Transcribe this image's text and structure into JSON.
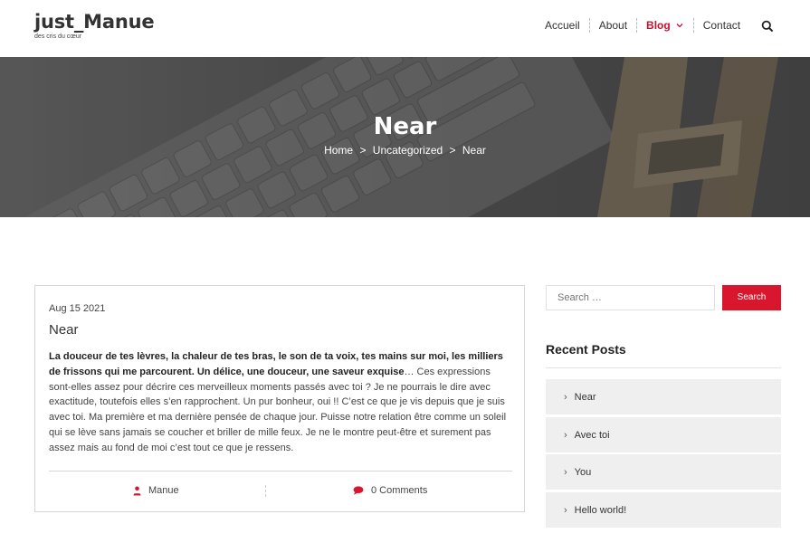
{
  "site": {
    "title": "just_Manue",
    "tagline": "des cris du cœur"
  },
  "nav": {
    "items": [
      {
        "label": "Accueil"
      },
      {
        "label": "About"
      },
      {
        "label": "Blog"
      },
      {
        "label": "Contact"
      }
    ]
  },
  "hero": {
    "title": "Near",
    "breadcrumb": [
      "Home",
      ">",
      "Uncategorized",
      ">",
      "Near"
    ]
  },
  "post": {
    "date": "Aug 15 2021",
    "title": "Near",
    "lead": "La douceur de tes lèvres, la chaleur de tes bras, le son de ta voix, tes mains sur moi, les milliers de frissons qui me parcourent. Un délice, une douceur, une saveur exquise",
    "body": "… Ces expressions sont-elles assez pour décrire ces merveilleux moments passés avec toi ? Je ne pourrais le dire avec exactitude, toutefois elles s’en rapprochent. Un pur bonheur, oui !! C’est ce que je vis depuis que je suis avec toi. Ma première et ma dernière pensée de chaque jour. Puisse notre relation être comme un soleil qui se lève sans jamais se coucher et briller de mille feux. Je ne le montre peut-être et surement pas assez mais au fond de moi c’est tout ce que je ressens.",
    "author": "Manue",
    "comments": "0 Comments"
  },
  "sidebar": {
    "search_placeholder": "Search …",
    "search_button": "Search",
    "recent_heading": "Recent Posts",
    "recent_posts": [
      {
        "label": "Near"
      },
      {
        "label": "Avec toi"
      },
      {
        "label": "You"
      },
      {
        "label": "Hello world!"
      }
    ]
  },
  "colors": {
    "accent": "#d8162d",
    "nav_active": "#c8102e"
  }
}
